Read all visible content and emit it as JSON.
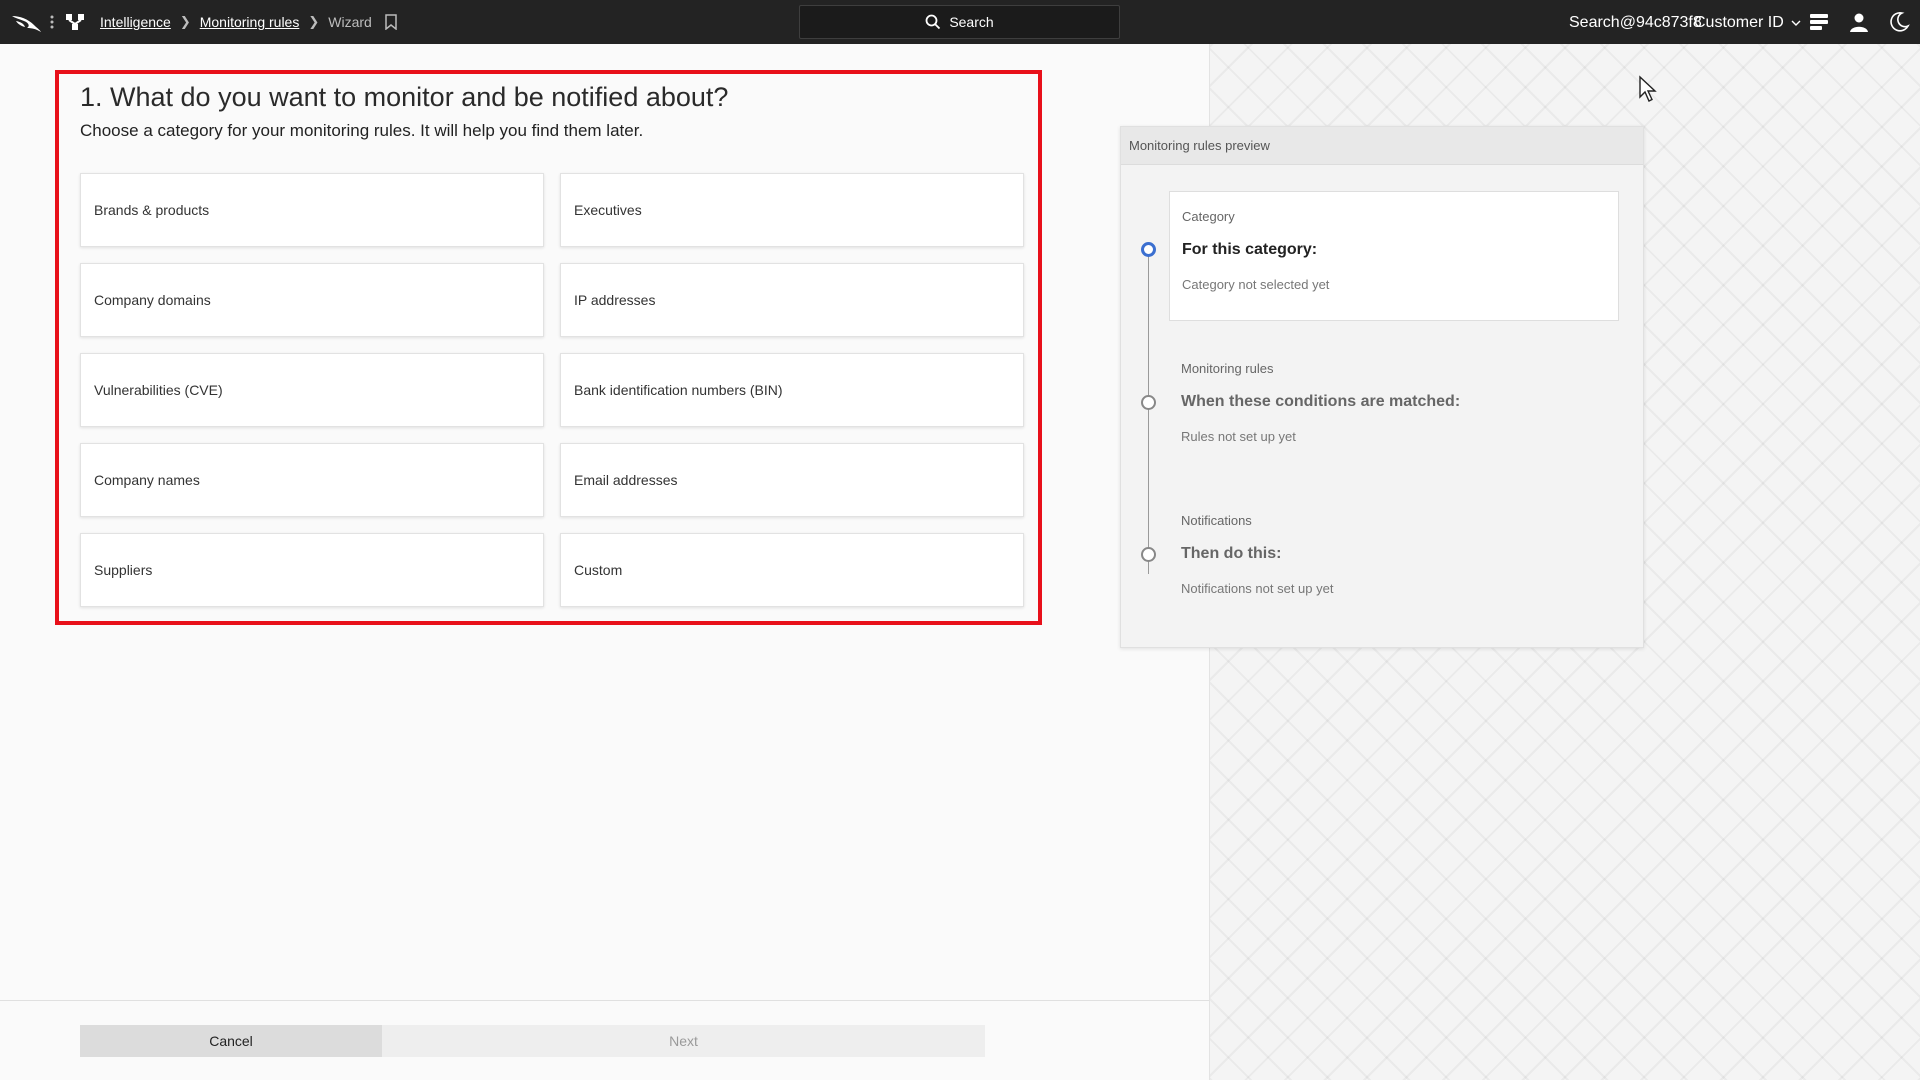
{
  "topbar": {
    "breadcrumbs": [
      "Intelligence",
      "Monitoring rules"
    ],
    "current_page": "Wizard",
    "search_label": "Search",
    "user": "Search@94c873f8",
    "customer_label": "Customer ID",
    "bg_color": "#232323"
  },
  "wizard": {
    "title": "1. What do you want to monitor and be notified about?",
    "subtitle": "Choose a category for your monitoring rules. It will help you find them later.",
    "options": [
      "Brands & products",
      "Executives",
      "Company domains",
      "IP addresses",
      "Vulnerabilities (CVE)",
      "Bank identification numbers (BIN)",
      "Company names",
      "Email addresses",
      "Suppliers",
      "Custom"
    ],
    "cancel_label": "Cancel",
    "next_label": "Next",
    "highlight_color": "#e8101a"
  },
  "preview": {
    "title": "Monitoring rules preview",
    "steps": [
      {
        "label": "Category",
        "heading": "For this category:",
        "status": "Category not selected yet"
      },
      {
        "label": "Monitoring rules",
        "heading": "When these conditions are matched:",
        "status": "Rules not set up yet"
      },
      {
        "label": "Notifications",
        "heading": "Then do this:",
        "status": "Notifications not set up yet"
      }
    ],
    "active_color": "#3b6fd0"
  }
}
